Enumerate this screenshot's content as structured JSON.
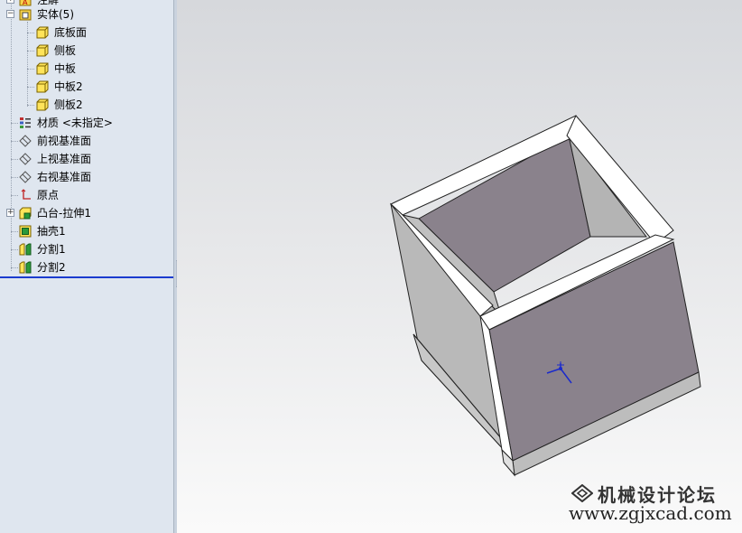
{
  "feature_tree": {
    "items": [
      {
        "label": "注解",
        "indent": 1
      },
      {
        "label": "实体(5)",
        "indent": 1,
        "expanded": true
      },
      {
        "label": "底板面",
        "indent": 2
      },
      {
        "label": "侧板",
        "indent": 2
      },
      {
        "label": "中板",
        "indent": 2
      },
      {
        "label": "中板2",
        "indent": 2
      },
      {
        "label": "侧板2",
        "indent": 2
      },
      {
        "label": "材质 <未指定>",
        "indent": 1
      },
      {
        "label": "前视基准面",
        "indent": 1
      },
      {
        "label": "上视基准面",
        "indent": 1
      },
      {
        "label": "右视基准面",
        "indent": 1
      },
      {
        "label": "原点",
        "indent": 1
      },
      {
        "label": "凸台-拉伸1",
        "indent": 1
      },
      {
        "label": "抽壳1",
        "indent": 1
      },
      {
        "label": "分割1",
        "indent": 1
      },
      {
        "label": "分割2",
        "indent": 1
      }
    ]
  },
  "icons": {
    "annotation": "annotation-folder-icon",
    "solid_bodies": "solid-bodies-folder-icon",
    "body": "solid-body-icon",
    "material": "material-icon",
    "plane": "plane-icon",
    "origin": "origin-icon",
    "extrude": "extrude-boss-icon",
    "shell": "shell-icon",
    "split": "split-icon"
  },
  "watermark": {
    "title": "机械设计论坛",
    "url": "www.zgjxcad.com"
  },
  "colors": {
    "tree_background": "#dfe6ef",
    "rollback_bar": "#1b3ccf",
    "body_face_light": "#ffffff",
    "body_face_shadow": "#8a828c",
    "body_face_side": "#b8b8b8"
  }
}
